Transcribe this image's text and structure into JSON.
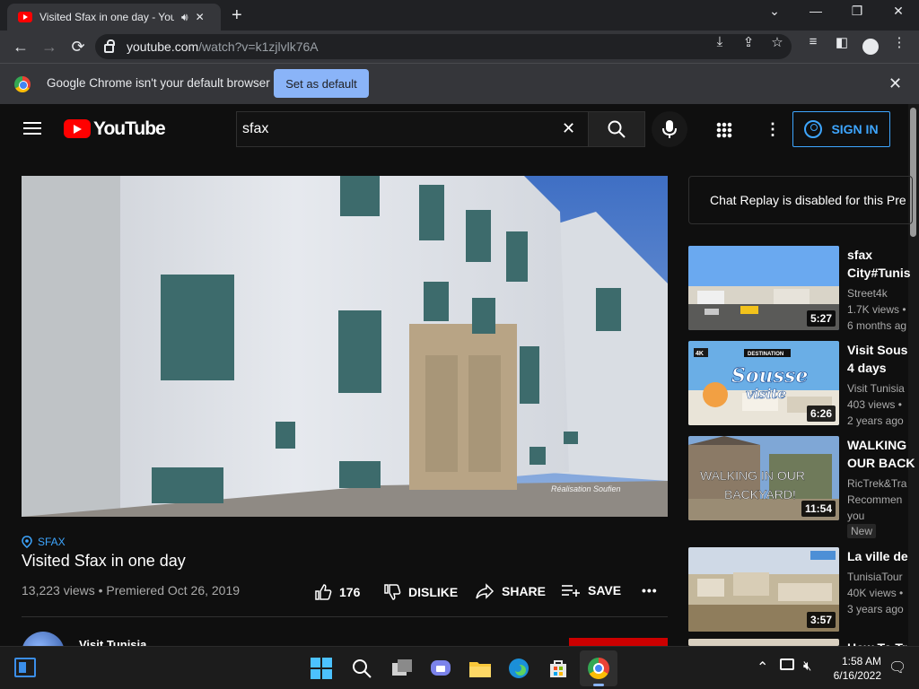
{
  "browser": {
    "tab_title": "Visited Sfax in one day - You",
    "url_host": "youtube.com",
    "url_path": "/watch?v=k1zjlvlk76A"
  },
  "infobar": {
    "message": "Google Chrome isn't your default browser",
    "button_label": "Set as default"
  },
  "youtube": {
    "logo_text": "YouTube",
    "search_value": "sfax",
    "sign_in_label": "SIGN IN",
    "video": {
      "location": "SFAX",
      "title": "Visited Sfax in one day",
      "stats": "13,223 views • Premiered Oct 26, 2019",
      "watermark": "Réalisation Soufien",
      "like_count": "176",
      "dislike_label": "DISLIKE",
      "share_label": "SHARE",
      "save_label": "SAVE",
      "more": "•••"
    },
    "channel": {
      "name": "Visit Tunisia"
    },
    "chat_replay": "Chat Replay is disabled for this Pre",
    "recommendations": [
      {
        "title": "sfax City#Tunis",
        "line1": "sfax",
        "line2": "City#Tunis",
        "channel": "Street4k",
        "views": "1.7K views •",
        "age": "6 months ag",
        "duration": "5:27"
      },
      {
        "title": "Visit Sous 4 days",
        "line1": "Visit Sous",
        "line2": "4 days",
        "channel": "Visit Tunisia",
        "views": "403 views •",
        "age": "2 years ago",
        "duration": "6:26",
        "thumb_text_1": "DESTINATION",
        "thumb_text_2": "Sousse",
        "thumb_text_3": "visite",
        "thumb_text_4": "4K"
      },
      {
        "title": "WALKING OUR BACK",
        "line1": "WALKING",
        "line2": "OUR BACK",
        "channel": "RicTrek&Tra",
        "views": "Recommen",
        "age": "you",
        "badge": "New",
        "duration": "11:54",
        "thumb_text_1": "WALKING IN OUR",
        "thumb_text_2": "BACKYARD!"
      },
      {
        "title": "La ville de",
        "line1": "La ville de",
        "line2": "",
        "channel": "TunisiaTour",
        "views": "40K views •",
        "age": "3 years ago",
        "duration": "3:57"
      },
      {
        "title": "How To Tr",
        "line1": "How To Tr",
        "line2": "",
        "channel": "",
        "views": "",
        "age": "",
        "duration": ""
      }
    ]
  },
  "taskbar": {
    "time": "1:58 AM",
    "date": "6/16/2022"
  }
}
